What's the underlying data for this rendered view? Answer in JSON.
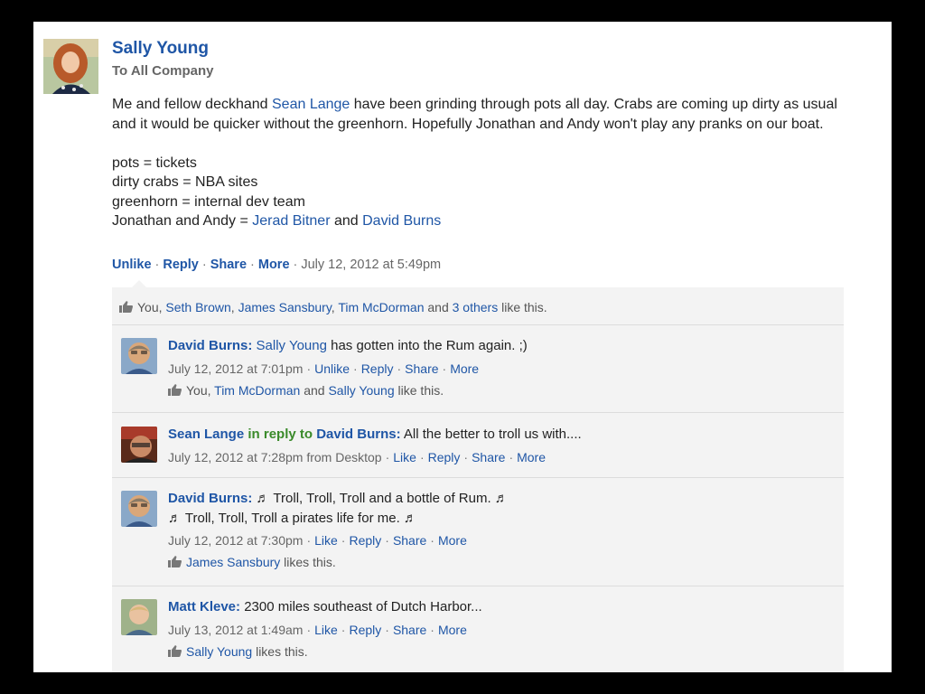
{
  "post": {
    "author": "Sally Young",
    "audience": "To All Company",
    "body": {
      "l1_a": "Me and fellow deckhand ",
      "l1_link": "Sean Lange",
      "l1_b": " have been grinding through pots all day. Crabs are coming up dirty as usual and it would be quicker without the greenhorn. Hopefully Jonathan and Andy won't play any pranks on our boat.",
      "l2": "pots = tickets",
      "l3": "dirty crabs = NBA sites",
      "l4": "greenhorn = internal dev team",
      "l5_a": "Jonathan and Andy = ",
      "l5_link1": "Jerad Bitner",
      "l5_and": " and ",
      "l5_link2": "David Burns"
    },
    "actions": {
      "unlike": "Unlike",
      "reply": "Reply",
      "share": "Share",
      "more": "More",
      "timestamp": "July 12, 2012 at 5:49pm"
    },
    "likes": {
      "you": "You, ",
      "p1": "Seth Brown",
      "c1": ", ",
      "p2": "James Sansbury",
      "c2": ", ",
      "p3": "Tim McDorman",
      "and": " and ",
      "others": "3 others",
      "tail": " like this."
    }
  },
  "replies": [
    {
      "name": "David Burns:",
      "mention": "Sally Young",
      "text": " has gotten into the Rum again. ;)",
      "meta_time": "July 12, 2012 at 7:01pm",
      "a1": "Unlike",
      "a2": "Reply",
      "a3": "Share",
      "a4": "More",
      "likes_a": "You, ",
      "likes_p1": "Tim McDorman",
      "likes_and": " and ",
      "likes_p2": "Sally Young",
      "likes_tail": " like this."
    },
    {
      "name": "Sean Lange",
      "inreply": " in reply to ",
      "target": "David Burns:",
      "text": " All the better to troll us with....",
      "meta_time": "July 12, 2012 at 7:28pm from Desktop",
      "a1": "Like",
      "a2": "Reply",
      "a3": "Share",
      "a4": "More"
    },
    {
      "name": "David Burns:",
      "text1": " ♬ Troll, Troll, Troll and a bottle of Rum. ♬",
      "text2": "♬ Troll, Troll, Troll a pirates life for me. ♬",
      "meta_time": "July 12, 2012 at 7:30pm",
      "a1": "Like",
      "a2": "Reply",
      "a3": "Share",
      "a4": "More",
      "likes_p1": "James Sansbury",
      "likes_tail": " likes this."
    },
    {
      "name": "Matt Kleve:",
      "text": " 2300 miles southeast of Dutch Harbor...",
      "meta_time": "July 13, 2012 at 1:49am",
      "a1": "Like",
      "a2": "Reply",
      "a3": "Share",
      "a4": "More",
      "likes_p1": "Sally Young",
      "likes_tail": " likes this."
    }
  ],
  "sep": " · ",
  "colors": {
    "link": "#1f56a6",
    "in_reply": "#3a8a2a",
    "thread_bg": "#f3f3f3"
  },
  "icons": {
    "like": "thumbs-up-icon"
  }
}
